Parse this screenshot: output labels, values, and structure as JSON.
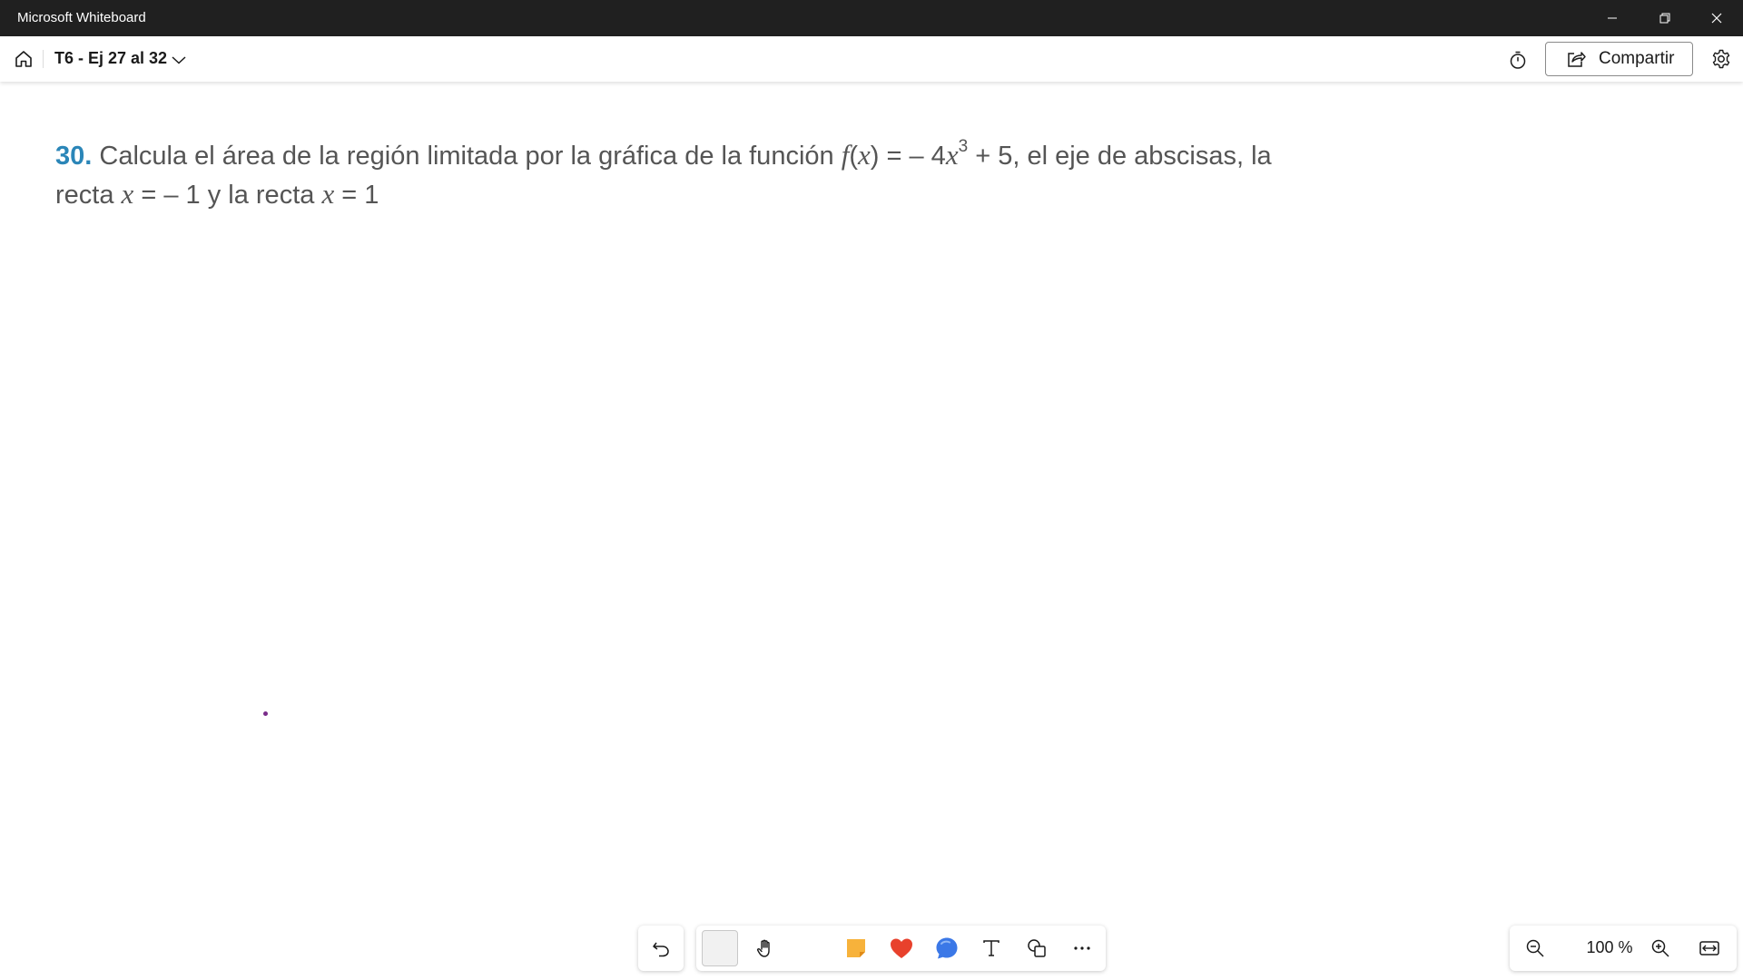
{
  "window": {
    "title": "Microsoft Whiteboard",
    "controls": [
      "minimize-icon",
      "restore-icon",
      "close-icon"
    ]
  },
  "header": {
    "board_name": "T6 - Ej 27 al 32",
    "share_label": "Compartir",
    "icons": [
      "home-icon",
      "chevron-down-icon",
      "timer-icon",
      "share-icon",
      "gear-icon"
    ]
  },
  "canvas": {
    "problem": {
      "number": "30.",
      "line1_a": "Calcula el área de la región limitada por la gráfica de la función ",
      "f_name": "f",
      "f_paren_open": "(",
      "f_var": "x",
      "f_paren_close": ")",
      "eq_mid": " = – 4",
      "x_cubed_var": "x",
      "exponent": "3",
      "line1_b": " + 5, el eje de abscisas, la",
      "line2_a": "recta ",
      "x1": "x",
      "line2_b": " = – 1 y la recta ",
      "x2": "x",
      "line2_c": " = 1"
    }
  },
  "toolbar": {
    "tools": [
      "undo-icon",
      "select-tool",
      "hand-icon",
      "sticky-note-icon",
      "heart-reaction-icon",
      "comment-icon",
      "text-icon",
      "shapes-icon",
      "more-icon"
    ],
    "colors": {
      "sticky_note": "#f7b23b",
      "heart": "#e8412c",
      "comment": "#3b78e7",
      "problem_number": "#2b86b8"
    }
  },
  "zoom": {
    "level": "100 %",
    "icons": [
      "zoom-out-icon",
      "zoom-in-icon",
      "fit-to-screen-icon"
    ]
  }
}
